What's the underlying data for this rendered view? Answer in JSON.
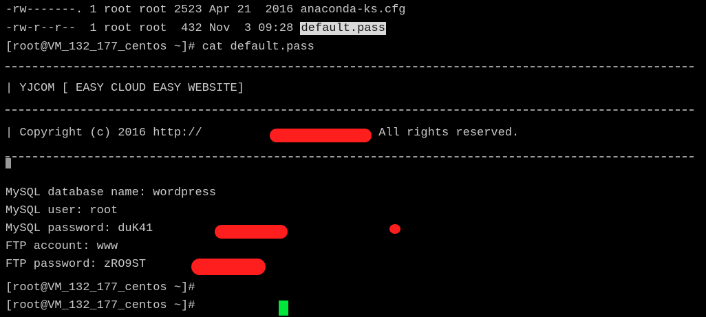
{
  "terminal": {
    "lines": [
      "-rw-------. 1 root root 2523 Apr 21  2016 anaconda-ks.cfg",
      "-rw-r--r--  1 root root  432 Nov  3 09:28 ",
      "[root@VM_132_177_centos ~]# cat default.pass",
      "| YJCOM [ EASY CLOUD EASY WEBSITE]",
      "| Copyright (c) 2016 http://",
      " All rights reserved.",
      "MySQL database name: wordpress",
      "MySQL user: root",
      "MySQL password: duK41",
      "FTP account: www",
      "FTP password: zRO9ST",
      "[root@VM_132_177_centos ~]#",
      "[root@VM_132_177_centos ~]# "
    ],
    "highlighted_filename": "default.pass",
    "cursor_color": "#00e63a",
    "redaction_color": "#ff1e1e"
  }
}
